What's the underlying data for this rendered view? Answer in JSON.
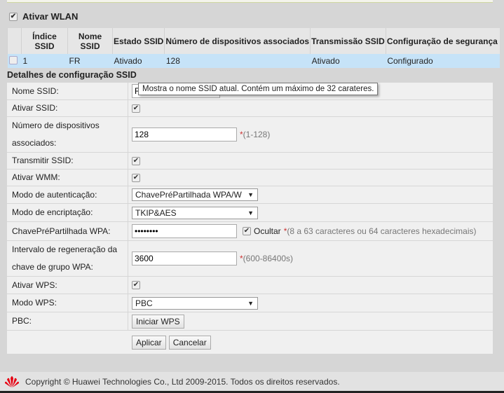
{
  "wlan": {
    "label": "Ativar WLAN",
    "checked": true
  },
  "table": {
    "headers": [
      "",
      "Índice SSID",
      "Nome SSID",
      "Estado SSID",
      "Número de dispositivos associados",
      "Transmissão SSID",
      "Configuração de segurança"
    ],
    "rows": [
      {
        "checked": false,
        "cells": [
          "1",
          "FR",
          "Ativado",
          "128",
          "Ativado",
          "Configurado"
        ]
      }
    ],
    "selected_color": "#c6e3f8"
  },
  "section_title": "Detalhes de configuração SSID",
  "form": {
    "ssid_name": {
      "label": "Nome SSID:",
      "value": "FR"
    },
    "enable_ssid": {
      "label": "Ativar SSID:",
      "checked": true
    },
    "devices": {
      "label": "Número de dispositivos associados:",
      "value": "128",
      "hint": "(1-128)"
    },
    "broadcast": {
      "label": "Transmitir SSID:",
      "checked": true
    },
    "wmm": {
      "label": "Ativar WMM:",
      "checked": true
    },
    "auth": {
      "label": "Modo de autenticação:",
      "value": "ChavePréPartilhada WPA/W"
    },
    "encryption": {
      "label": "Modo de encriptação:",
      "value": "TKIP&AES"
    },
    "psk": {
      "label": "ChavePréPartilhada WPA:",
      "value": "••••••••",
      "hide_label": "Ocultar",
      "hide_checked": true,
      "hint": "(8 a 63 caracteres ou 64 caracteres hexadecimais)"
    },
    "rekey": {
      "label": "Intervalo de regeneração da chave de grupo WPA:",
      "value": "3600",
      "hint": "(600-86400s)"
    },
    "wps": {
      "label": "Ativar WPS:",
      "checked": true
    },
    "wps_mode": {
      "label": "Modo WPS:",
      "value": "PBC"
    },
    "pbc": {
      "label": "PBC:",
      "button": "Iniciar WPS"
    },
    "apply": "Aplicar",
    "cancel": "Cancelar",
    "required_mark": "*"
  },
  "tooltip": "Mostra o nome SSID atual. Contém um máximo de 32 carateres.",
  "footer": {
    "text": "Copyright © Huawei Technologies Co., Ltd 2009-2015. Todos os direitos reservados.",
    "logo_color": "#e60012"
  }
}
